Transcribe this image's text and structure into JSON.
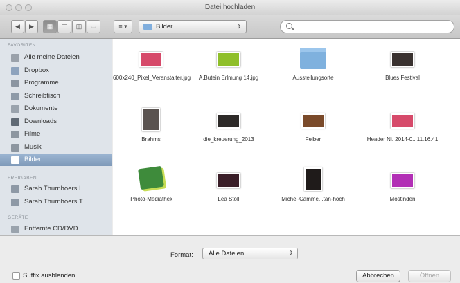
{
  "window": {
    "title": "Datei hochladen"
  },
  "toolbar": {
    "back": "◀",
    "forward": "▶",
    "view_buttons": [
      "▦",
      "☰",
      "◫",
      "▭"
    ],
    "arrange": "≡ ▾",
    "location": "Bilder",
    "location_arrows": "⇕",
    "search_placeholder": ""
  },
  "sidebar": {
    "favorites_header": "FAVORITEN",
    "favorites": [
      {
        "label": "Alle meine Dateien",
        "icon": "all-files-icon",
        "color": "#9aa1aa"
      },
      {
        "label": "Dropbox",
        "icon": "dropbox-folder-icon",
        "color": "#8ea3bd"
      },
      {
        "label": "Programme",
        "icon": "applications-icon",
        "color": "#8b95a1"
      },
      {
        "label": "Schreibtisch",
        "icon": "desktop-icon",
        "color": "#8e9aa8"
      },
      {
        "label": "Dokumente",
        "icon": "documents-icon",
        "color": "#9aa3ad"
      },
      {
        "label": "Downloads",
        "icon": "downloads-icon",
        "color": "#606a75"
      },
      {
        "label": "Filme",
        "icon": "movies-icon",
        "color": "#8d96a0"
      },
      {
        "label": "Musik",
        "icon": "music-icon",
        "color": "#8d96a0"
      },
      {
        "label": "Bilder",
        "icon": "pictures-icon",
        "color": "#ffffff"
      }
    ],
    "shared_header": "FREIGABEN",
    "shared": [
      {
        "label": "Sarah Thurnhoers I...",
        "icon": "network-computer-icon",
        "color": "#8e99a6"
      },
      {
        "label": "Sarah Thurnhoers T...",
        "icon": "network-computer-icon",
        "color": "#8e99a6"
      }
    ],
    "devices_header": "GERÄTE",
    "devices": [
      {
        "label": "Entfernte CD/DVD",
        "icon": "remote-disc-icon",
        "color": "#9aa3ad"
      }
    ]
  },
  "files": [
    {
      "name": "600x240_Pixel_Veranstalter.jpg",
      "icon": "image-thumbnail-icon",
      "thumb_color": "#d64a6a"
    },
    {
      "name": "A.Butein Erlmung 14.jpg",
      "icon": "image-thumbnail-icon",
      "thumb_color": "#8fbf2a"
    },
    {
      "name": "Ausstellungsorte",
      "icon": "folder-icon",
      "thumb_color": "#7fb1de"
    },
    {
      "name": "Blues Festival",
      "icon": "image-thumbnail-icon",
      "thumb_color": "#3a3230"
    },
    {
      "name": "Brahms",
      "icon": "image-thumbnail-icon",
      "thumb_color": "#5a5350"
    },
    {
      "name": "die_kreuerung_2013",
      "icon": "image-thumbnail-icon",
      "thumb_color": "#2d2a28"
    },
    {
      "name": "Felber",
      "icon": "image-thumbnail-icon",
      "thumb_color": "#7a4a2a"
    },
    {
      "name": "Header Ni. 2014-0...11.16.41",
      "icon": "image-thumbnail-icon",
      "thumb_color": "#d64a6a"
    },
    {
      "name": "iPhoto-Mediathek",
      "icon": "iphoto-library-icon",
      "thumb_color": "#3e8b3b"
    },
    {
      "name": "Lea Stoll",
      "icon": "image-thumbnail-icon",
      "thumb_color": "#3a1e28"
    },
    {
      "name": "Michel-Camme...tan-hoch",
      "icon": "image-thumbnail-icon",
      "thumb_color": "#1f1b1a"
    },
    {
      "name": "Mostinden",
      "icon": "image-thumbnail-icon",
      "thumb_color": "#b22fb5"
    }
  ],
  "footer": {
    "format_label": "Format:",
    "format_value": "Alle Dateien",
    "format_arrows": "⇕",
    "suffix_label": "Suffix ausblenden",
    "cancel_label": "Abbrechen",
    "open_label": "Öffnen"
  }
}
